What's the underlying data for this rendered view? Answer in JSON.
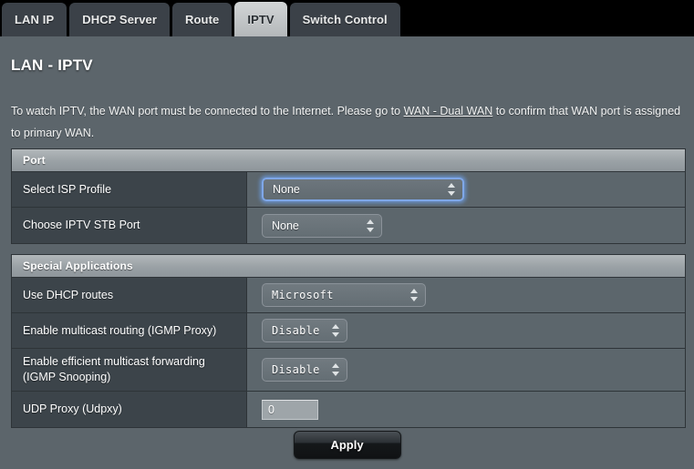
{
  "tabs": [
    {
      "label": "LAN IP",
      "active": false
    },
    {
      "label": "DHCP Server",
      "active": false
    },
    {
      "label": "Route",
      "active": false
    },
    {
      "label": "IPTV",
      "active": true
    },
    {
      "label": "Switch Control",
      "active": false
    }
  ],
  "page": {
    "title": "LAN - IPTV",
    "description_before": "To watch IPTV, the WAN port must be connected to the Internet. Please go to ",
    "description_link": "WAN - Dual WAN",
    "description_after": " to confirm that WAN port is assigned to primary WAN."
  },
  "sections": [
    {
      "heading": "Port",
      "rows": [
        {
          "label": "Select ISP Profile",
          "control": "select",
          "value": "None",
          "focused": true,
          "mono": false
        },
        {
          "label": "Choose IPTV STB Port",
          "control": "select",
          "value": "None",
          "focused": false,
          "mono": false
        }
      ]
    },
    {
      "heading": "Special Applications",
      "rows": [
        {
          "label": "Use DHCP routes",
          "control": "select",
          "value": "Microsoft",
          "focused": false,
          "mono": true
        },
        {
          "label": "Enable multicast routing (IGMP Proxy)",
          "control": "select",
          "value": "Disable",
          "focused": false,
          "mono": true
        },
        {
          "label": "Enable efficient multicast forwarding (IGMP Snooping)",
          "control": "select",
          "value": "Disable",
          "focused": false,
          "mono": true
        },
        {
          "label": "UDP Proxy (Udpxy)",
          "control": "text",
          "value": "0",
          "focused": false,
          "mono": false
        }
      ]
    }
  ],
  "footer": {
    "apply_label": "Apply"
  },
  "colors": {
    "page_background": "#5c656b",
    "tabbar_background": "#000000",
    "tab_inactive": "#3b4148",
    "tab_active": "#c3c7c9",
    "label_cell": "#3c444a",
    "value_cell": "#5c666c",
    "section_header": "#9aa1a5",
    "focus_glow": "#7fa7e8",
    "border": "#2e3438"
  }
}
